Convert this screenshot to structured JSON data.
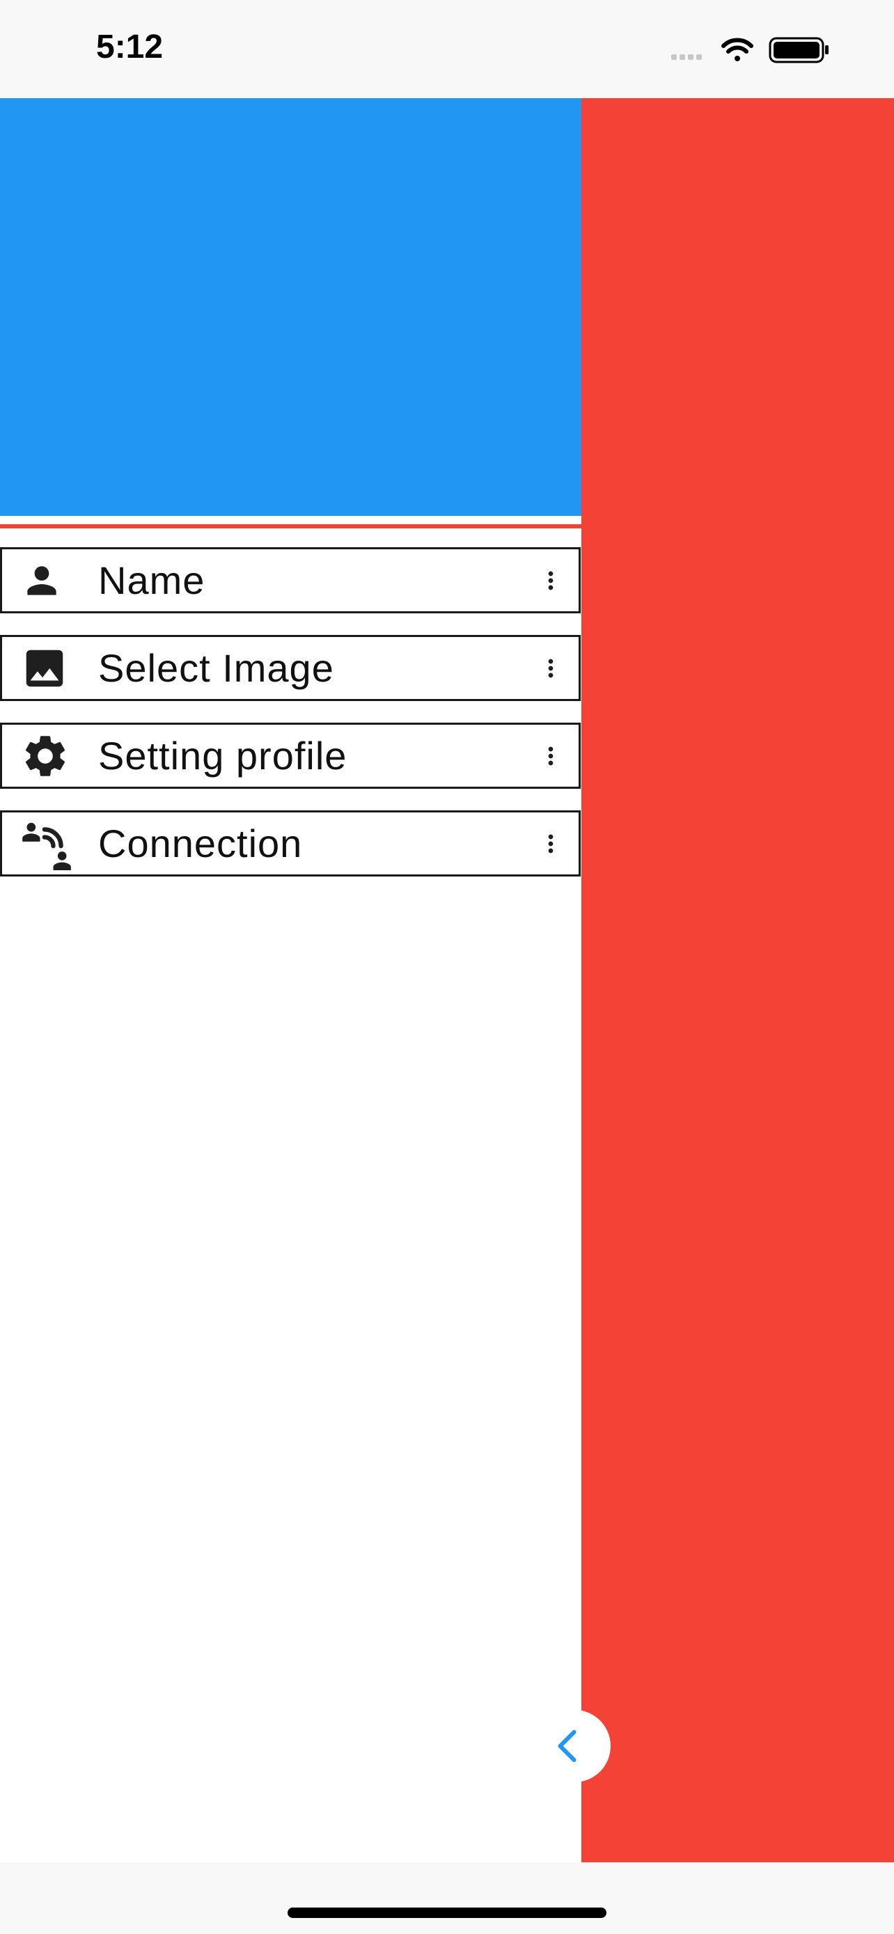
{
  "status_bar": {
    "time": "5:12",
    "icons": [
      "signal-icon",
      "wifi-icon",
      "battery-icon"
    ]
  },
  "colors": {
    "drawer_header": "#2196f3",
    "side_panel": "#f44336",
    "divider": "#f44336",
    "handle_chevron": "#2196f3"
  },
  "drawer": {
    "menu": [
      {
        "label": "Name",
        "icon": "person-icon"
      },
      {
        "label": "Select Image",
        "icon": "image-icon"
      },
      {
        "label": "Setting profile",
        "icon": "gear-icon"
      },
      {
        "label": "Connection",
        "icon": "connection-icon"
      }
    ],
    "more_icon": "more-vert-icon"
  },
  "collapse_handle": {
    "icon": "chevron-left-icon"
  }
}
